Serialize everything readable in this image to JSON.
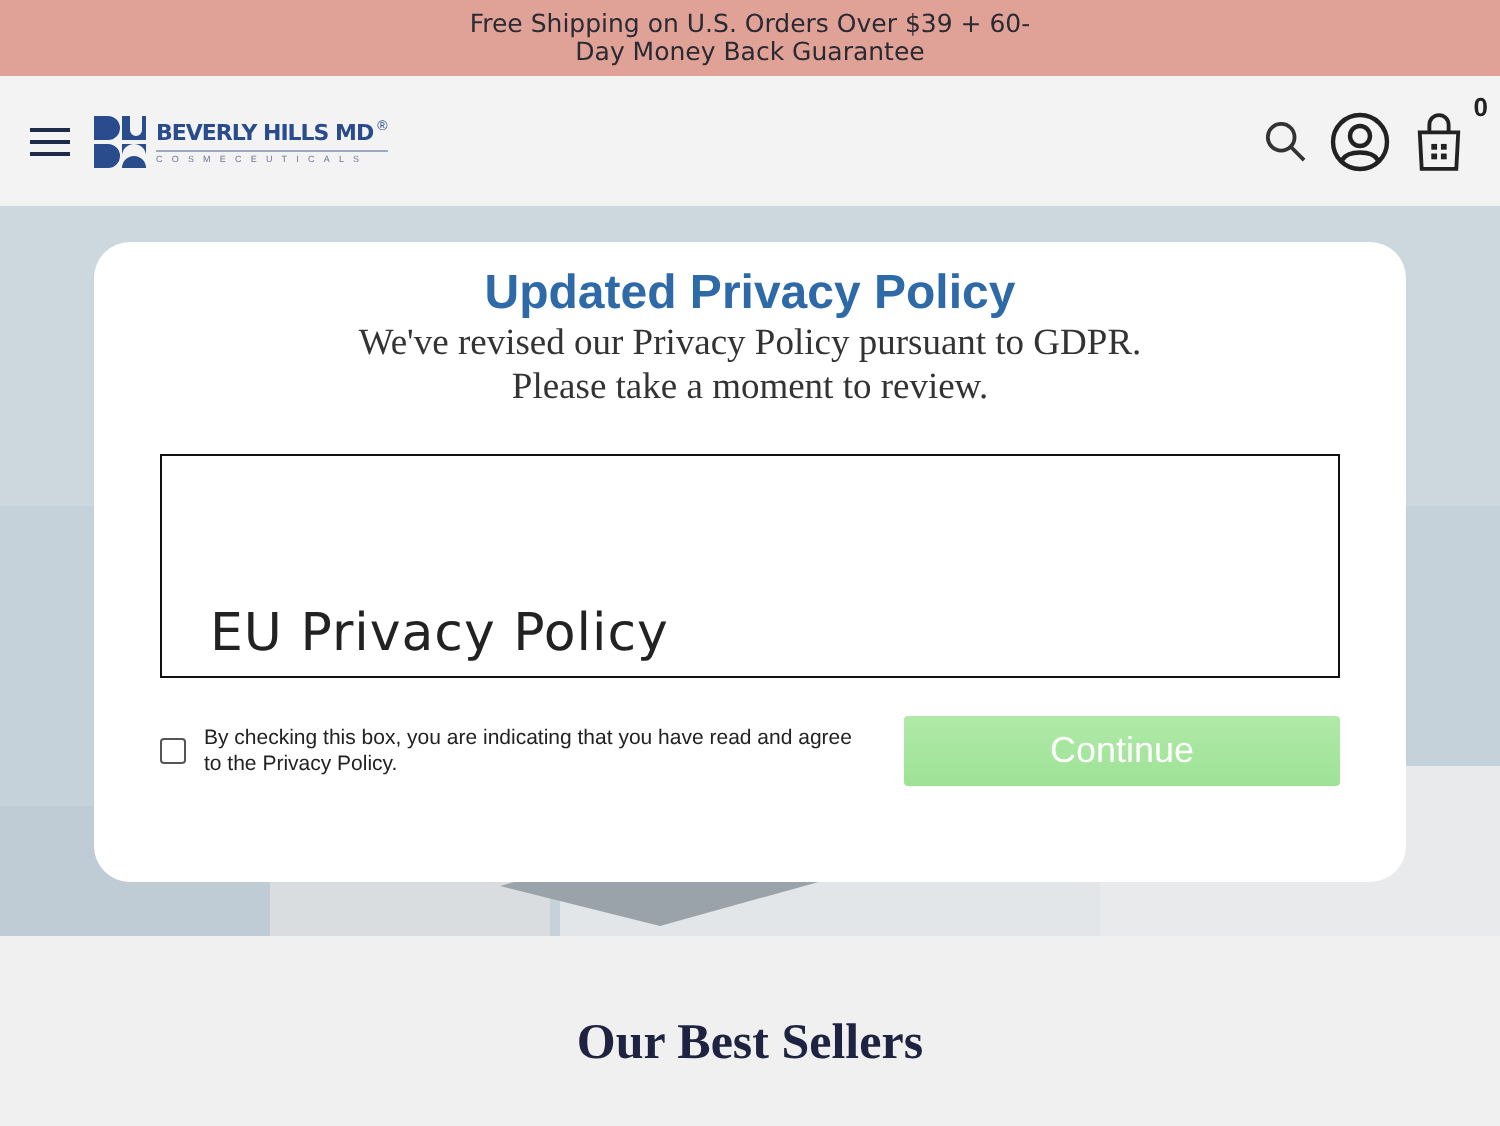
{
  "banner": {
    "text": "Free Shipping on U.S. Orders Over $39 + 60-Day Money Back Guarantee"
  },
  "header": {
    "logo": {
      "name": "BEVERLY HILLS MD",
      "mark": "®",
      "tagline": "COSMECEUTICALS"
    },
    "cart_count": "0"
  },
  "modal": {
    "title": "Updated Privacy Policy",
    "subtitle_lines": [
      "We've revised our Privacy Policy pursuant to GDPR.",
      "Please take a moment to review."
    ],
    "policy_heading": "EU Privacy Policy",
    "consent": {
      "label": "By checking this box, you are indicating that you have read and agree to the Privacy Policy.",
      "checked": false
    },
    "continue_button": {
      "label": "Continue",
      "disabled": true
    }
  },
  "section": {
    "title": "Our Best Sellers"
  }
}
